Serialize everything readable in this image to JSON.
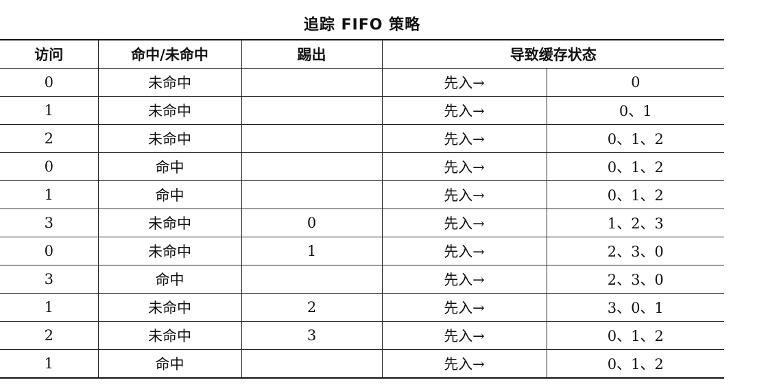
{
  "caption": "追踪 FIFO 策略",
  "headers": {
    "access": "访问",
    "hit_miss": "命中/未命中",
    "evict": "踢出",
    "cache_state": "导致缓存状态"
  },
  "rows": [
    {
      "access": "0",
      "result": "未命中",
      "evict": "",
      "state_label": "先入→",
      "state": "0"
    },
    {
      "access": "1",
      "result": "未命中",
      "evict": "",
      "state_label": "先入→",
      "state": "0、1"
    },
    {
      "access": "2",
      "result": "未命中",
      "evict": "",
      "state_label": "先入→",
      "state": "0、1、2"
    },
    {
      "access": "0",
      "result": "命中",
      "evict": "",
      "state_label": "先入→",
      "state": "0、1、2"
    },
    {
      "access": "1",
      "result": "命中",
      "evict": "",
      "state_label": "先入→",
      "state": "0、1、2"
    },
    {
      "access": "3",
      "result": "未命中",
      "evict": "0",
      "state_label": "先入→",
      "state": "1、2、3"
    },
    {
      "access": "0",
      "result": "未命中",
      "evict": "1",
      "state_label": "先入→",
      "state": "2、3、0"
    },
    {
      "access": "3",
      "result": "命中",
      "evict": "",
      "state_label": "先入→",
      "state": "2、3、0"
    },
    {
      "access": "1",
      "result": "未命中",
      "evict": "2",
      "state_label": "先入→",
      "state": "3、0、1"
    },
    {
      "access": "2",
      "result": "未命中",
      "evict": "3",
      "state_label": "先入→",
      "state": "0、1、2"
    },
    {
      "access": "1",
      "result": "命中",
      "evict": "",
      "state_label": "先入→",
      "state": "0、1、2"
    }
  ]
}
